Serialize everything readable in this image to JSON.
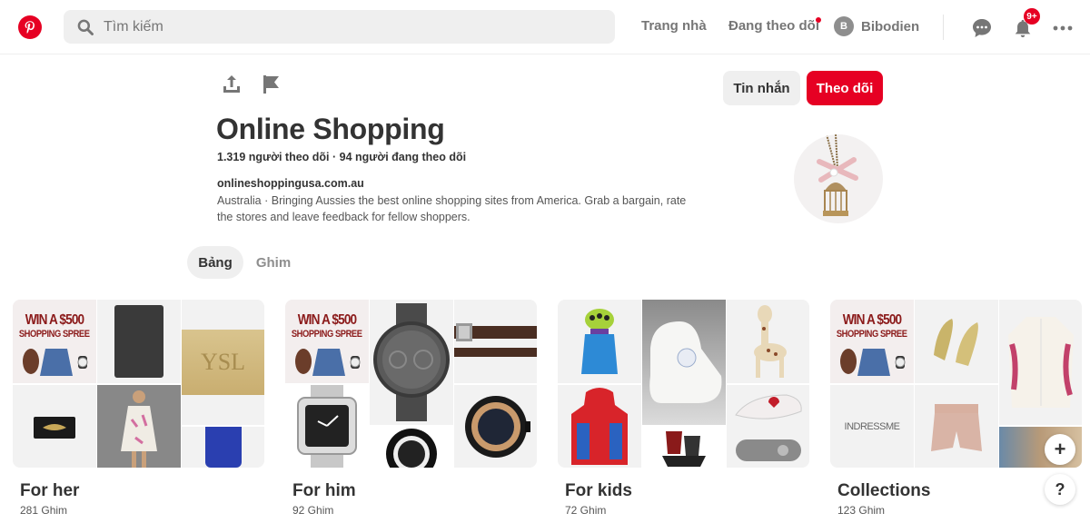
{
  "header": {
    "logo": "pinterest-logo",
    "search_placeholder": "Tìm kiếm",
    "nav": {
      "home": "Trang nhà",
      "following": "Đang theo dõi",
      "following_has_dot": true
    },
    "user": {
      "initial": "B",
      "name": "Bibodien"
    },
    "notifications_badge": "9+",
    "icons": [
      "messages-icon",
      "notifications-bell-icon",
      "more-options-icon"
    ]
  },
  "profile": {
    "actions": [
      "share-icon",
      "report-flag-icon"
    ],
    "message_button": "Tin nhắn",
    "follow_button": "Theo dõi",
    "title": "Online Shopping",
    "stats": "1.319 người theo dõi · 94 người đang theo dõi",
    "website": "onlineshoppingusa.com.au",
    "description": "Australia  ·  Bringing Aussies the best online shopping sites from America. Grab a bargain, rate the stores and leave feedback for fellow shoppers.",
    "avatar_image": "birdcage-necklace"
  },
  "tabs": [
    {
      "label": "Bảng",
      "active": true
    },
    {
      "label": "Ghim",
      "active": false
    }
  ],
  "promo": {
    "line1": "WIN A $500",
    "line2": "SHOPPING SPREE"
  },
  "brand_text": "INDRESSME",
  "boards": [
    {
      "name": "For her",
      "count": "281 Ghim"
    },
    {
      "name": "For him",
      "count": "92 Ghim"
    },
    {
      "name": "For kids",
      "count": "72 Ghim"
    },
    {
      "name": "Collections",
      "count": "123 Ghim"
    }
  ],
  "floating": {
    "add": "+",
    "help": "?"
  },
  "colors": {
    "brand_red": "#e60023",
    "text_dark": "#333333",
    "text_muted": "#767676",
    "pill_bg": "#efefef"
  }
}
